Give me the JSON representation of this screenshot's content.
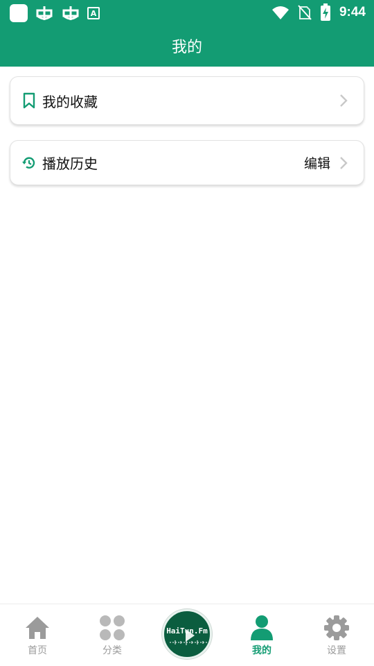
{
  "status_bar": {
    "time": "9:44",
    "badge_letter": "A",
    "icons": [
      "app-square-icon",
      "bug-icon",
      "bug-icon",
      "a-badge-icon",
      "wifi-icon",
      "no-sim-icon",
      "battery-charging-icon"
    ]
  },
  "app_bar": {
    "title": "我的"
  },
  "cards": {
    "favorites": {
      "label": "我的收藏",
      "icon": "bookmark-icon"
    },
    "history": {
      "label": "播放历史",
      "edit_label": "编辑",
      "icon": "history-icon"
    }
  },
  "tab_bar": {
    "tabs": [
      {
        "label": "首页",
        "icon": "home-icon",
        "active": false
      },
      {
        "label": "分类",
        "icon": "category-icon",
        "active": false
      },
      {
        "label": "我的",
        "icon": "person-icon",
        "active": true
      },
      {
        "label": "设置",
        "icon": "gear-icon",
        "active": false
      }
    ],
    "center_brand": "HaiTun.Fm"
  },
  "colors": {
    "primary": "#139c73",
    "inactive": "#9b9b9b",
    "center_button": "#0b5d3f"
  }
}
